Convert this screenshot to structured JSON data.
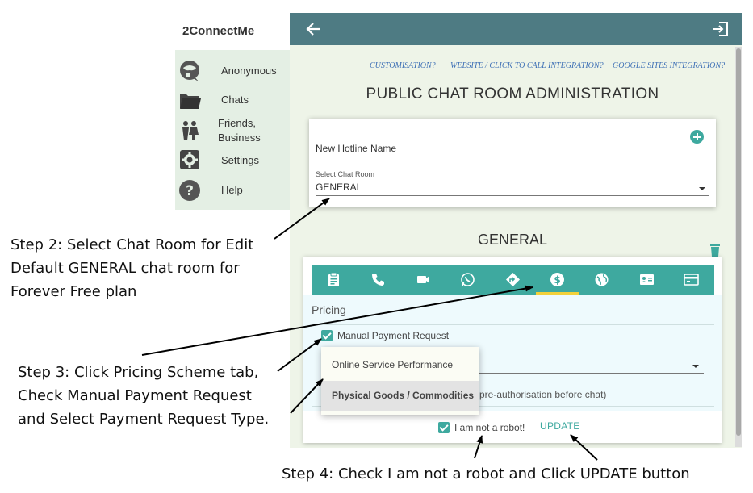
{
  "app": {
    "brand": "2ConnectMe"
  },
  "sidebar": {
    "items": [
      {
        "label": "Anonymous",
        "icon": "anonymous-avatar-icon"
      },
      {
        "label": "Chats",
        "icon": "folder-icon"
      },
      {
        "label": "Friends,",
        "label2": "Business",
        "icon": "people-icon"
      },
      {
        "label": "Settings",
        "icon": "gear-icon"
      },
      {
        "label": "Help",
        "icon": "help-icon"
      }
    ]
  },
  "header": {
    "back_icon": "arrow-left-icon",
    "exit_icon": "exit-icon",
    "color": "#4e7b83"
  },
  "links": [
    "CUSTOMISATION?",
    "WEBSITE / CLICK TO CALL INTEGRATION?",
    "GOOGLE SITES INTEGRATION?"
  ],
  "page_title": "PUBLIC CHAT ROOM ADMINISTRATION",
  "hotline": {
    "name_value": "New Hotline Name",
    "select_label": "Select Chat Room",
    "select_value": "GENERAL"
  },
  "room": {
    "title": "GENERAL",
    "tabs": [
      "clipboard-icon",
      "phone-icon",
      "video-icon",
      "whatsapp-icon",
      "directions-icon",
      "dollar-icon",
      "globe-icon",
      "contact-card-icon",
      "payment-card-icon"
    ],
    "active_tab": 5,
    "section": "Pricing",
    "manual_payment_label": "Manual Payment Request",
    "dropdown_options": [
      "Online Service Performance",
      "Physical Goods / Commodities"
    ],
    "selected_option": "Physical Goods / Commodities",
    "hint_text": "pre-authorisation before chat)",
    "robot_label": "I am not a robot!",
    "update_label": "UPDATE"
  },
  "colors": {
    "accent": "#3ea99f",
    "active_tab_underline": "#f2d13b",
    "link": "#3d6fb5"
  },
  "annotations": {
    "step2": [
      "Step 2: Select Chat Room for Edit",
      "Default GENERAL chat room for",
      "Forever Free plan"
    ],
    "step3": [
      "Step 3: Click Pricing Scheme tab,",
      "Check Manual Payment Request",
      "and Select Payment Request Type."
    ],
    "step4": "Step 4: Check I am not a robot and Click UPDATE button"
  }
}
